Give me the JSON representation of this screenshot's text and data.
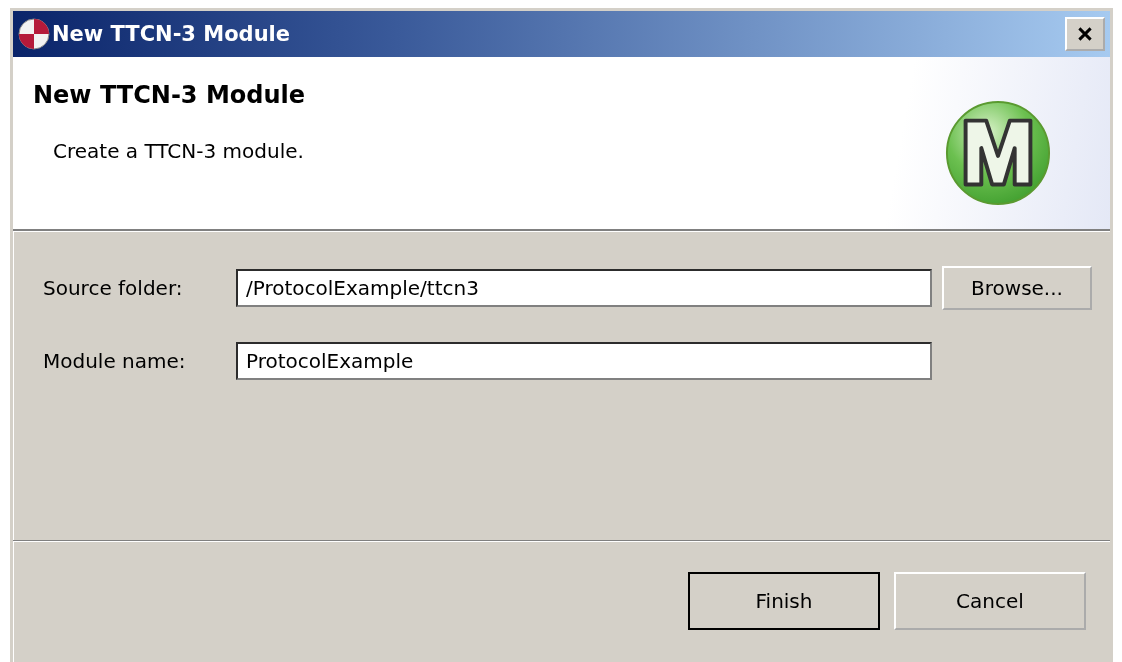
{
  "window": {
    "title": "New TTCN-3 Module"
  },
  "header": {
    "title": "New TTCN-3 Module",
    "description": "Create a TTCN-3 module."
  },
  "fields": [
    {
      "label": "Source folder:",
      "value": "/ProtocolExample/ttcn3",
      "button": "Browse..."
    },
    {
      "label": "Module name:",
      "value": "ProtocolExample"
    }
  ],
  "buttons": [
    {
      "label": "Finish",
      "default": true
    },
    {
      "label": "Cancel",
      "default": false
    }
  ]
}
